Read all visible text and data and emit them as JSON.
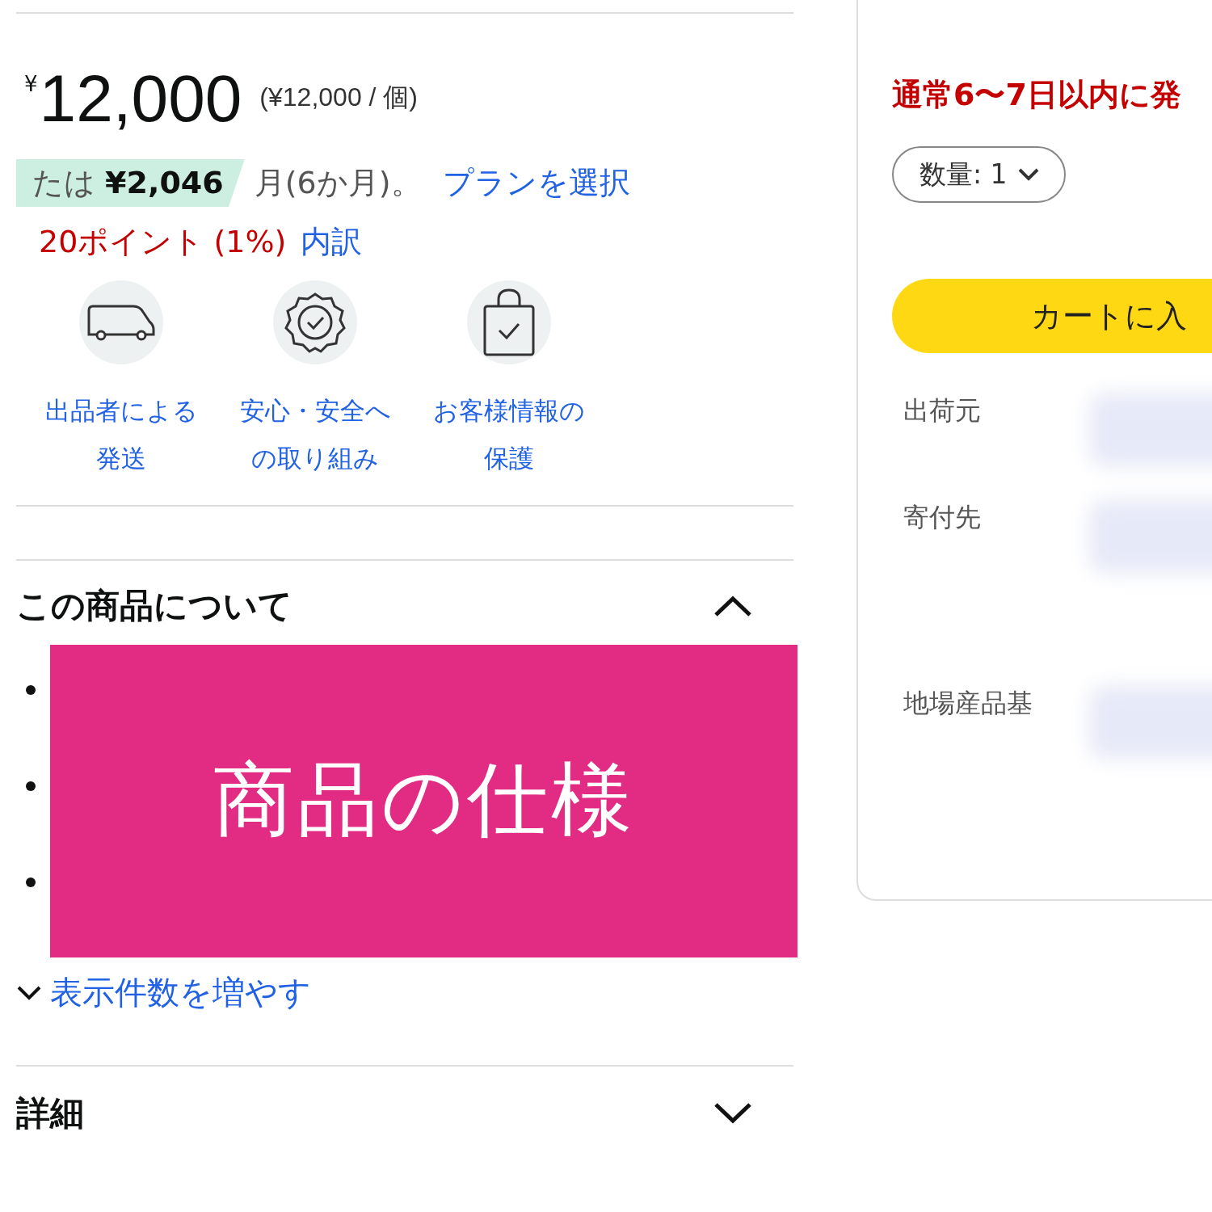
{
  "price": {
    "currency": "¥",
    "amount": "12,000",
    "unit_price": "(¥12,000 / 個)"
  },
  "installment": {
    "prefix": "たは",
    "amount": "¥2,046",
    "suffix": "月(6か月)。",
    "link": "プランを選択"
  },
  "points": {
    "text": "20ポイント (1%)",
    "link": "内訳"
  },
  "features": [
    {
      "kind": "truck",
      "lines": [
        "出品者による",
        "発送"
      ]
    },
    {
      "kind": "badge",
      "lines": [
        "安心・安全へ",
        "の取り組み"
      ]
    },
    {
      "kind": "bag",
      "lines": [
        "お客様情報の",
        "保護"
      ]
    }
  ],
  "about": {
    "title": "この商品について",
    "expanded": true
  },
  "overlay": {
    "label": "商品の仕様"
  },
  "show_more": "表示件数を増やす",
  "details": {
    "title": "詳細",
    "expanded": false
  },
  "buybox": {
    "delivery": "通常6〜7日以内に発",
    "quantity": "数量: 1",
    "cart_button": "カートに入",
    "info_rows": [
      "出荷元",
      "寄付先",
      "地場産品基"
    ]
  }
}
